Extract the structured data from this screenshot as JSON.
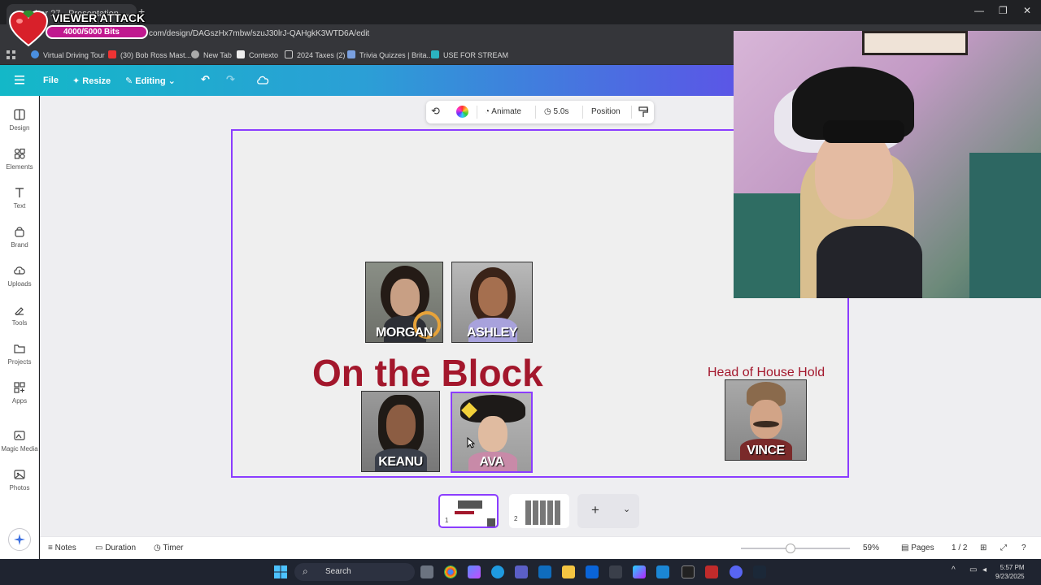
{
  "browser": {
    "tab_title": "...ber 27 - Presentation",
    "tab_close": "×",
    "new_tab": "+",
    "url": "com/design/DAGszHx7mbw/szuJ30lrJ-QAHgkK3WTD6A/edit",
    "win_minimize": "—",
    "win_restore": "❐",
    "win_close": "✕",
    "bookmarks": [
      "Virtual Driving Tour",
      "(30) Bob Ross Mast...",
      "New Tab",
      "Contexto",
      "2024 Taxes (2)",
      "Trivia Quizzes | Brita...",
      "USE FOR STREAM"
    ]
  },
  "overlay": {
    "title": "VIEWER ATTACK",
    "bits": "4000/5000 Bits",
    "progress": 0.8
  },
  "header": {
    "file": "File",
    "resize": "Resize",
    "editing": "Editing"
  },
  "sidebar": {
    "items": [
      "Design",
      "Elements",
      "Text",
      "Brand",
      "Uploads",
      "Tools",
      "Projects",
      "Apps",
      "Magic Media",
      "Photos"
    ]
  },
  "toolbar": {
    "animate": "Animate",
    "duration": "5.0s",
    "position": "Position"
  },
  "slide": {
    "title": "On the Block",
    "head_label": "Head of House Hold",
    "contestants": [
      "MORGAN",
      "ASHLEY",
      "KEANU",
      "AVA"
    ],
    "hoh": "VINCE"
  },
  "footer": {
    "notes": "Notes",
    "duration": "Duration",
    "timer": "Timer",
    "zoom": "59%",
    "pages": "Pages",
    "page_count": "1 / 2"
  },
  "pages_strip": {
    "thumb1_num": "1",
    "thumb2_num": "2",
    "add": "+"
  },
  "taskbar": {
    "search": "Search",
    "time": "5:57 PM",
    "date": "9/23/2025"
  }
}
